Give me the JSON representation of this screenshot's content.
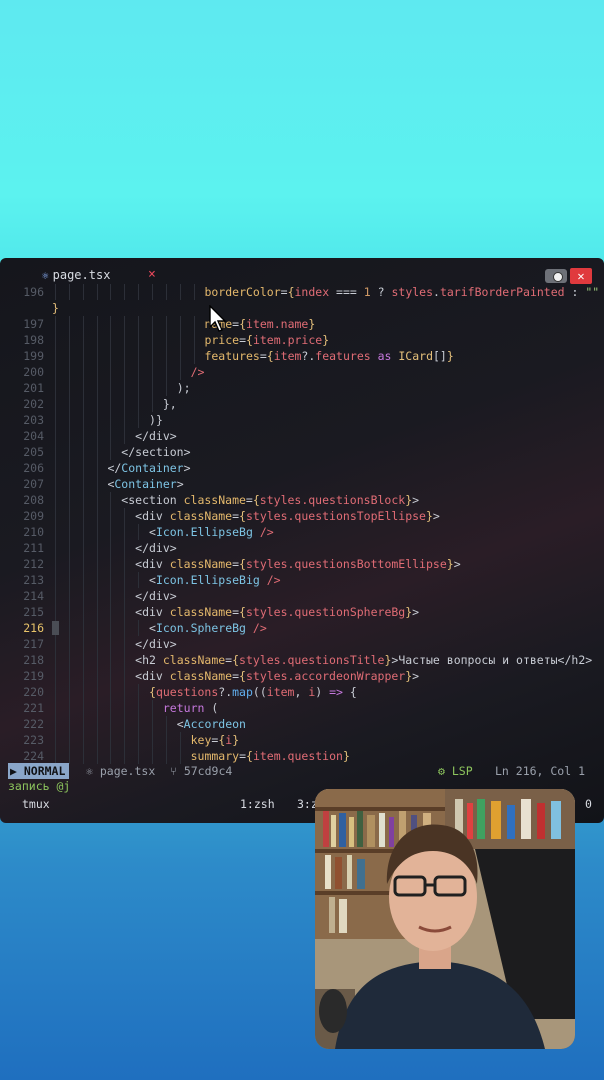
{
  "tab": {
    "icon": "react-icon",
    "filename": "page.tsx",
    "close": "×"
  },
  "window": {
    "close": "✕"
  },
  "code_lines": [
    {
      "num": "196",
      "indent": 11,
      "parts": [
        [
          "a",
          "borderColor"
        ],
        [
          "t",
          "="
        ],
        [
          "y",
          "{"
        ],
        [
          "v",
          "index"
        ],
        [
          "t",
          " === "
        ],
        [
          "n",
          "1"
        ],
        [
          "t",
          " ? "
        ],
        [
          "v",
          "styles"
        ],
        [
          "t",
          "."
        ],
        [
          "v",
          "tarifBorderPainted"
        ],
        [
          "t",
          " : "
        ],
        [
          "s",
          "\"\""
        ]
      ]
    },
    {
      "num": "",
      "indent": 0,
      "parts": [
        [
          "y",
          "}"
        ]
      ]
    },
    {
      "num": "197",
      "indent": 11,
      "parts": [
        [
          "a",
          "name"
        ],
        [
          "t",
          "="
        ],
        [
          "y",
          "{"
        ],
        [
          "v",
          "item.name"
        ],
        [
          "y",
          "}"
        ]
      ]
    },
    {
      "num": "198",
      "indent": 11,
      "parts": [
        [
          "a",
          "price"
        ],
        [
          "t",
          "="
        ],
        [
          "y",
          "{"
        ],
        [
          "v",
          "item.price"
        ],
        [
          "y",
          "}"
        ]
      ]
    },
    {
      "num": "199",
      "indent": 11,
      "parts": [
        [
          "a",
          "features"
        ],
        [
          "t",
          "="
        ],
        [
          "y",
          "{"
        ],
        [
          "v",
          "item"
        ],
        [
          "t",
          "?."
        ],
        [
          "v",
          "features"
        ],
        [
          "k",
          " as "
        ],
        [
          "y",
          "ICard"
        ],
        [
          "t",
          "[]"
        ],
        [
          "y",
          "}"
        ]
      ]
    },
    {
      "num": "200",
      "indent": 10,
      "parts": [
        [
          "v",
          "/>"
        ]
      ]
    },
    {
      "num": "201",
      "indent": 9,
      "parts": [
        [
          "t",
          ");"
        ]
      ]
    },
    {
      "num": "202",
      "indent": 8,
      "parts": [
        [
          "t",
          "},"
        ]
      ]
    },
    {
      "num": "203",
      "indent": 7,
      "parts": [
        [
          "t",
          ")}"
        ]
      ]
    },
    {
      "num": "204",
      "indent": 6,
      "parts": [
        [
          "t",
          "</div>"
        ]
      ]
    },
    {
      "num": "205",
      "indent": 5,
      "parts": [
        [
          "t",
          "</section>"
        ]
      ]
    },
    {
      "num": "206",
      "indent": 4,
      "parts": [
        [
          "t",
          "</"
        ],
        [
          "tag",
          "Container"
        ],
        [
          "t",
          ">"
        ]
      ]
    },
    {
      "num": "207",
      "indent": 4,
      "parts": [
        [
          "t",
          "<"
        ],
        [
          "tag",
          "Container"
        ],
        [
          "t",
          ">"
        ]
      ]
    },
    {
      "num": "208",
      "indent": 5,
      "parts": [
        [
          "t",
          "<section "
        ],
        [
          "a",
          "className"
        ],
        [
          "t",
          "="
        ],
        [
          "y",
          "{"
        ],
        [
          "v",
          "styles.questionsBlock"
        ],
        [
          "y",
          "}"
        ],
        [
          "t",
          ">"
        ]
      ]
    },
    {
      "num": "209",
      "indent": 6,
      "parts": [
        [
          "t",
          "<div "
        ],
        [
          "a",
          "className"
        ],
        [
          "t",
          "="
        ],
        [
          "y",
          "{"
        ],
        [
          "v",
          "styles.questionsTopEllipse"
        ],
        [
          "y",
          "}"
        ],
        [
          "t",
          ">"
        ]
      ]
    },
    {
      "num": "210",
      "indent": 7,
      "parts": [
        [
          "t",
          "<"
        ],
        [
          "tag",
          "Icon.EllipseBg"
        ],
        [
          "v",
          " />"
        ]
      ]
    },
    {
      "num": "211",
      "indent": 6,
      "parts": [
        [
          "t",
          "</div>"
        ]
      ]
    },
    {
      "num": "212",
      "indent": 6,
      "parts": [
        [
          "t",
          "<div "
        ],
        [
          "a",
          "className"
        ],
        [
          "t",
          "="
        ],
        [
          "y",
          "{"
        ],
        [
          "v",
          "styles.questionsBottomEllipse"
        ],
        [
          "y",
          "}"
        ],
        [
          "t",
          ">"
        ]
      ]
    },
    {
      "num": "213",
      "indent": 7,
      "parts": [
        [
          "t",
          "<"
        ],
        [
          "tag",
          "Icon.EllipseBig"
        ],
        [
          "v",
          " />"
        ]
      ]
    },
    {
      "num": "214",
      "indent": 6,
      "parts": [
        [
          "t",
          "</div>"
        ]
      ]
    },
    {
      "num": "215",
      "indent": 6,
      "parts": [
        [
          "t",
          "<div "
        ],
        [
          "a",
          "className"
        ],
        [
          "t",
          "="
        ],
        [
          "y",
          "{"
        ],
        [
          "v",
          "styles.questionSphereBg"
        ],
        [
          "y",
          "}"
        ],
        [
          "t",
          ">"
        ]
      ]
    },
    {
      "num": "216",
      "indent": 7,
      "current": true,
      "parts": [
        [
          "t",
          "<"
        ],
        [
          "tag",
          "Icon.SphereBg"
        ],
        [
          "v",
          " />"
        ]
      ]
    },
    {
      "num": "217",
      "indent": 6,
      "parts": [
        [
          "t",
          "</div>"
        ]
      ]
    },
    {
      "num": "218",
      "indent": 6,
      "parts": [
        [
          "t",
          "<h2 "
        ],
        [
          "a",
          "className"
        ],
        [
          "t",
          "="
        ],
        [
          "y",
          "{"
        ],
        [
          "v",
          "styles.questionsTitle"
        ],
        [
          "y",
          "}"
        ],
        [
          "t",
          ">Частые вопросы и ответы</h2>"
        ]
      ]
    },
    {
      "num": "219",
      "indent": 6,
      "parts": [
        [
          "t",
          "<div "
        ],
        [
          "a",
          "className"
        ],
        [
          "t",
          "="
        ],
        [
          "y",
          "{"
        ],
        [
          "v",
          "styles.accordeonWrapper"
        ],
        [
          "y",
          "}"
        ],
        [
          "t",
          ">"
        ]
      ]
    },
    {
      "num": "220",
      "indent": 7,
      "parts": [
        [
          "y",
          "{"
        ],
        [
          "v",
          "questions"
        ],
        [
          "t",
          "?."
        ],
        [
          "b",
          "map"
        ],
        [
          "t",
          "(("
        ],
        [
          "v",
          "item"
        ],
        [
          "t",
          ", "
        ],
        [
          "v",
          "i"
        ],
        [
          "t",
          ") "
        ],
        [
          "k",
          "=>"
        ],
        [
          "t",
          " {"
        ]
      ]
    },
    {
      "num": "221",
      "indent": 8,
      "parts": [
        [
          "k",
          "return"
        ],
        [
          "t",
          " ("
        ]
      ]
    },
    {
      "num": "222",
      "indent": 9,
      "parts": [
        [
          "t",
          "<"
        ],
        [
          "tag",
          "Accordeon"
        ]
      ]
    },
    {
      "num": "223",
      "indent": 10,
      "parts": [
        [
          "a",
          "key"
        ],
        [
          "t",
          "="
        ],
        [
          "y",
          "{"
        ],
        [
          "v",
          "i"
        ],
        [
          "y",
          "}"
        ]
      ]
    },
    {
      "num": "224",
      "indent": 10,
      "parts": [
        [
          "a",
          "summary"
        ],
        [
          "t",
          "="
        ],
        [
          "y",
          "{"
        ],
        [
          "v",
          "item.question"
        ],
        [
          "y",
          "}"
        ]
      ]
    }
  ],
  "statusbar": {
    "mode": "NORMAL",
    "file": "page.tsx",
    "commit": "57cd9c4",
    "lsp": "LSP",
    "position": "Ln 216, Col 1"
  },
  "cmdline": "запись @j",
  "tmux": {
    "session": "tmux",
    "window1": "1:zsh",
    "window2": "3:z",
    "right": "0"
  },
  "webcam": {
    "description_icon": "webcam-person"
  }
}
